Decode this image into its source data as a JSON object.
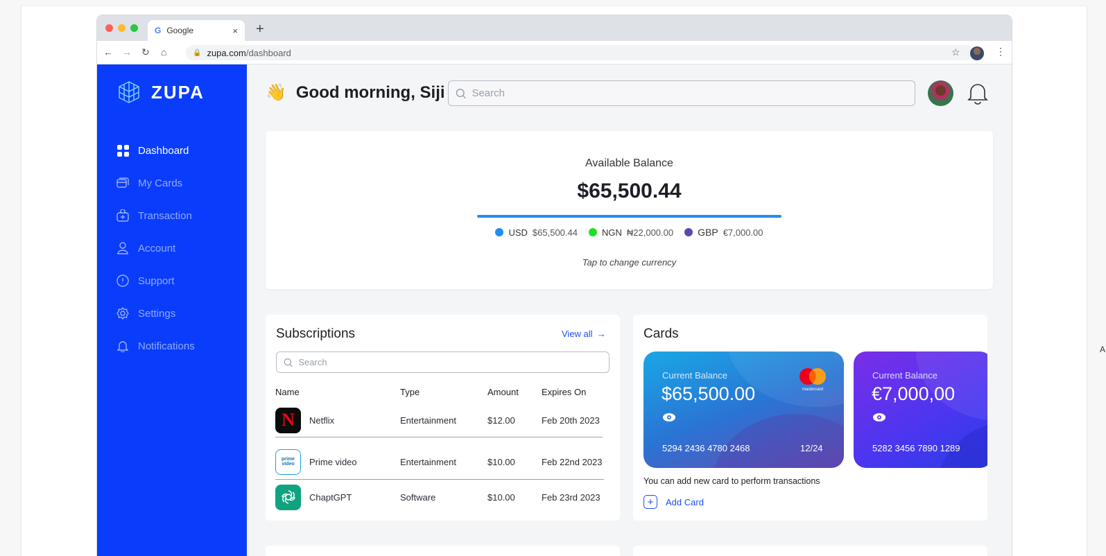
{
  "browser": {
    "tab_title": "Google",
    "tab_close": "×",
    "new_tab": "+",
    "url_host": "zupa.com",
    "url_path": "/dashboard",
    "traffic_colors": [
      "#ff5f57",
      "#febc2e",
      "#28c840"
    ]
  },
  "brand": {
    "name": "ZUPA",
    "sidebar_color": "#0a3dfb"
  },
  "sidebar": {
    "items": [
      {
        "label": "Dashboard",
        "icon": "grid-icon",
        "active": true
      },
      {
        "label": "My Cards",
        "icon": "cards-icon"
      },
      {
        "label": "Transaction",
        "icon": "transaction-icon"
      },
      {
        "label": "Account",
        "icon": "user-icon"
      },
      {
        "label": "Support",
        "icon": "info-icon"
      },
      {
        "label": "Settings",
        "icon": "gear-icon"
      },
      {
        "label": "Notifications",
        "icon": "bell-icon"
      }
    ]
  },
  "header": {
    "greeting": "Good morning, Siji",
    "wave": "👋",
    "search_placeholder": "Search"
  },
  "balance": {
    "label": "Available Balance",
    "amount": "$65,500.44",
    "currencies": [
      {
        "code": "USD",
        "value": "$65,500.44",
        "color": "#1f8ef0"
      },
      {
        "code": "NGN",
        "value": "₦22,000.00",
        "color": "#22dd22"
      },
      {
        "code": "GBP",
        "value": "€7,000.00",
        "color": "#5a4ab0"
      }
    ],
    "hint": "Tap to change currency"
  },
  "subscriptions": {
    "title": "Subscriptions",
    "view_all": "View all",
    "search_placeholder": "Search",
    "columns": [
      "Name",
      "Type",
      "Amount",
      "Expires On"
    ],
    "rows": [
      {
        "name": "Netflix",
        "type": "Entertainment",
        "amount": "$12.00",
        "expires": "Feb 20th 2023",
        "logo": "netflix-icon",
        "logo_text": "N"
      },
      {
        "name": "Prime video",
        "type": "Entertainment",
        "amount": "$10.00",
        "expires": "Feb 22nd 2023",
        "logo": "prime-video-icon",
        "logo_text": "prime video"
      },
      {
        "name": "ChaptGPT",
        "type": "Software",
        "amount": "$10.00",
        "expires": "Feb 23rd 2023",
        "logo": "chatgpt-icon",
        "logo_text": ""
      }
    ]
  },
  "cards": {
    "title": "Cards",
    "items": [
      {
        "label": "Current Balance",
        "amount": "$65,500.00",
        "number": "5294 2436 4780 2468",
        "expiry": "12/24",
        "brand": "mastercard"
      },
      {
        "label": "Current Balance",
        "amount": "€7,000,00",
        "number": "5282 3456 7890 1289",
        "expiry": ""
      }
    ],
    "note": "You can add new card to perform transactions",
    "add_label": "Add Card"
  }
}
